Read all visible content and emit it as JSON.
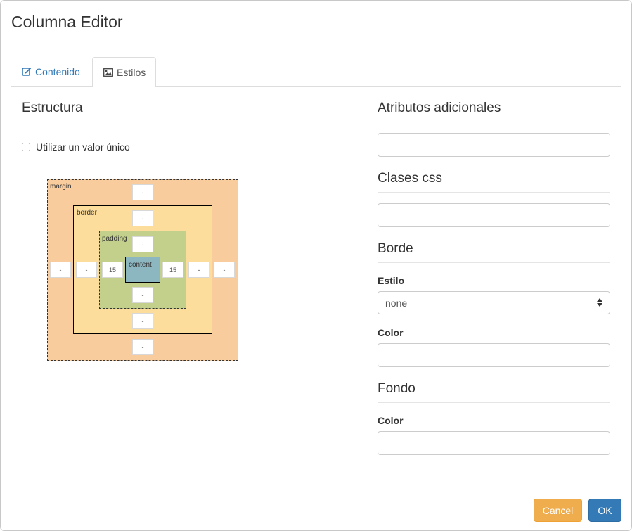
{
  "modal": {
    "title": "Columna Editor"
  },
  "tabs": [
    {
      "label": "Contenido",
      "icon": "edit-icon",
      "active": false
    },
    {
      "label": "Estilos",
      "icon": "image-icon",
      "active": true
    }
  ],
  "estructura": {
    "heading": "Estructura",
    "single_value_label": "Utilizar un valor único",
    "single_value_checked": false,
    "box_model": {
      "margin_label": "margin",
      "border_label": "border",
      "padding_label": "padding",
      "content_label": "content",
      "margin": {
        "top": "-",
        "right": "-",
        "bottom": "-",
        "left": "-"
      },
      "border": {
        "top": "-",
        "right": "-",
        "bottom": "-",
        "left": "-"
      },
      "padding": {
        "top": "-",
        "right": "15",
        "bottom": "-",
        "left": "15"
      }
    }
  },
  "atributos": {
    "heading": "Atributos adicionales",
    "value": ""
  },
  "clases": {
    "heading": "Clases css",
    "value": ""
  },
  "borde": {
    "heading": "Borde",
    "estilo_label": "Estilo",
    "estilo_value": "none",
    "color_label": "Color",
    "color_value": ""
  },
  "fondo": {
    "heading": "Fondo",
    "color_label": "Color",
    "color_value": ""
  },
  "footer": {
    "cancel_label": "Cancel",
    "ok_label": "OK"
  },
  "colors": {
    "link": "#337ab7",
    "cancel": "#f0ad4e",
    "ok": "#337ab7",
    "margin_bg": "#f9cc9d",
    "border_bg": "#fddd9b",
    "padding_bg": "#c3d08b",
    "content_bg": "#8cb6c0"
  }
}
